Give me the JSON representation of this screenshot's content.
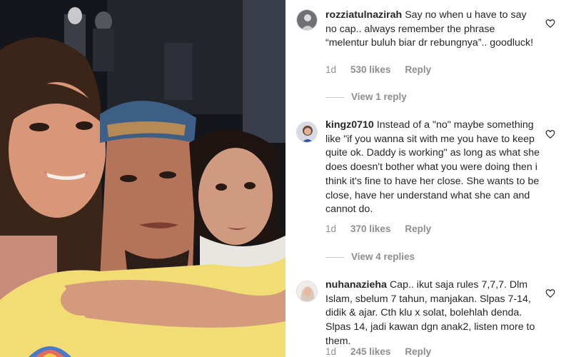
{
  "comments": [
    {
      "username": "rozziatulnazirah",
      "text": "Say no when u have to say no cap.. always remember the phrase “melentur buluh biar dr rebungnya”.. goodluck!",
      "time": "1d",
      "likes": "530 likes",
      "reply": "Reply",
      "view_replies": "View 1 reply"
    },
    {
      "username": "kingz0710",
      "text": "Instead of a \"no\" maybe something like \"if you wanna sit with me you have to keep quite ok. Daddy is working\" as long as what she does doesn't bother what you were doing then i think it's fine to have her close. She wants to be close, have her understand what she can and cannot do.",
      "time": "1d",
      "likes": "370 likes",
      "reply": "Reply",
      "view_replies": "View 4 replies"
    },
    {
      "username": "nuhanazieha",
      "text": "Cap.. ikut saja rules 7,7,7. Dlm Islam, sbelum 7 tahun, manjakan. Slpas 7-14, didik & ajar. Cth klu x solat, bolehlah denda. Slpas 14, jadi kawan dgn anak2, listen more to them.",
      "time": "1d",
      "likes": "245 likes",
      "reply": "Reply"
    }
  ],
  "colors": {
    "text": "#262626",
    "muted": "#8e8e8e"
  },
  "icons": {
    "like": "heart-outline-icon"
  }
}
